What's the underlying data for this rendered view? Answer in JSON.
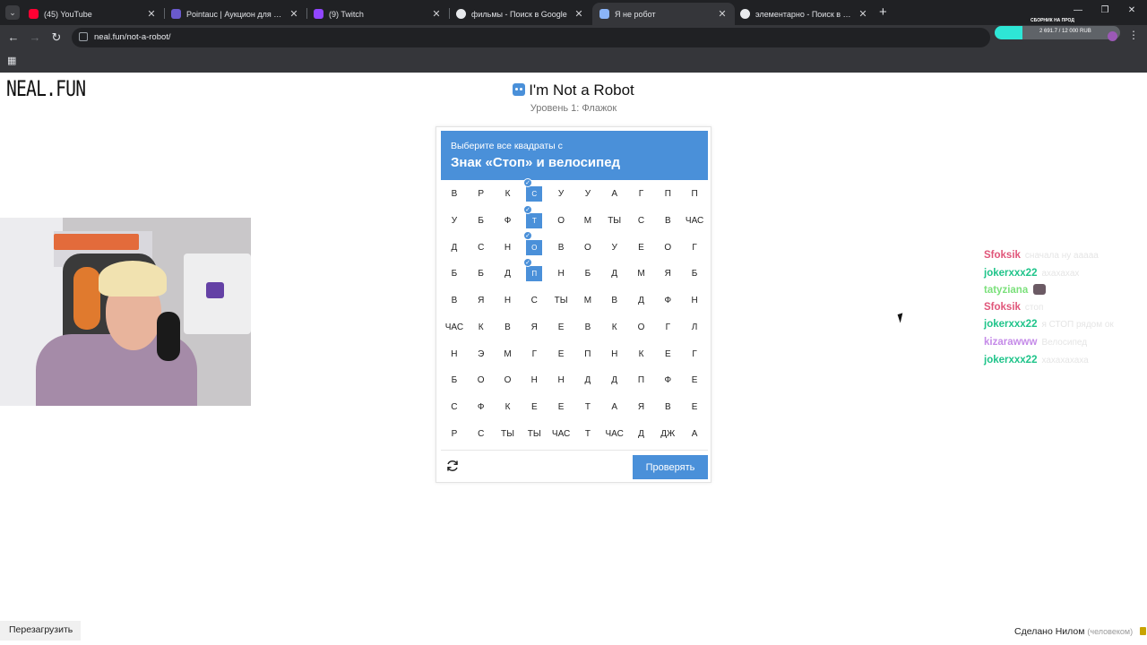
{
  "browser": {
    "tabs": [
      {
        "title": "(45) YouTube",
        "favicon_color": "#ff0033"
      },
      {
        "title": "Pointauc | Аукцион для стримеров",
        "favicon_color": "#6a5acd"
      },
      {
        "title": "(9) Twitch",
        "favicon_color": "#9146ff"
      },
      {
        "title": "фильмы - Поиск в Google",
        "favicon_color": "#e8eaed"
      },
      {
        "title": "Я не робот",
        "favicon_color": "#8ab4f8"
      },
      {
        "title": "элементарно - Поиск в Google",
        "favicon_color": "#e8eaed"
      }
    ],
    "active_tab_index": 4,
    "url": "neal.fun/not-a-robot/",
    "extension": {
      "title": "СБОРНИК НА ПРОД",
      "progress_text": "2 691.7 / 12 000 RUB",
      "progress_fraction": 0.22
    }
  },
  "page": {
    "logo": "NEAL.FUN",
    "title": "I'm Not a Robot",
    "subtitle": "Уровень 1: Флажок"
  },
  "captcha": {
    "instruction_small": "Выберите все квадраты с",
    "instruction_big": "Знак «Стоп» и велосипед",
    "grid": [
      [
        "В",
        "Р",
        "К",
        "С",
        "У",
        "У",
        "А",
        "Г",
        "П",
        "П"
      ],
      [
        "У",
        "Б",
        "Ф",
        "Т",
        "О",
        "М",
        "ТЫ",
        "С",
        "В",
        "ЧАС"
      ],
      [
        "Д",
        "С",
        "Н",
        "О",
        "В",
        "О",
        "У",
        "Е",
        "О",
        "Г"
      ],
      [
        "Б",
        "Б",
        "Д",
        "П",
        "Н",
        "Б",
        "Д",
        "М",
        "Я",
        "Б"
      ],
      [
        "В",
        "Я",
        "Н",
        "С",
        "ТЫ",
        "М",
        "В",
        "Д",
        "Ф",
        "Н"
      ],
      [
        "ЧАС",
        "К",
        "В",
        "Я",
        "Е",
        "В",
        "К",
        "О",
        "Г",
        "Л"
      ],
      [
        "Н",
        "Э",
        "М",
        "Г",
        "Е",
        "П",
        "Н",
        "К",
        "Е",
        "Г"
      ],
      [
        "Б",
        "О",
        "О",
        "Н",
        "Н",
        "Д",
        "Д",
        "П",
        "Ф",
        "Е"
      ],
      [
        "С",
        "Ф",
        "К",
        "Е",
        "Е",
        "Т",
        "А",
        "Я",
        "В",
        "Е"
      ],
      [
        "Р",
        "С",
        "ТЫ",
        "ТЫ",
        "ЧАС",
        "Т",
        "ЧАС",
        "Д",
        "ДЖ",
        "А"
      ]
    ],
    "selected": [
      [
        0,
        3
      ],
      [
        1,
        3
      ],
      [
        2,
        3
      ],
      [
        3,
        3
      ]
    ],
    "verify_label": "Проверять"
  },
  "chat": [
    {
      "user": "Sfoksik",
      "color": "#e0567a",
      "text": "сначала ну ааааа"
    },
    {
      "user": "jokerxxx22",
      "color": "#1fc48a",
      "text": "ахахахах"
    },
    {
      "user": "tatyziana",
      "color": "#7be07b",
      "text": ""
    },
    {
      "user": "Sfoksik",
      "color": "#e0567a",
      "text": "стоп"
    },
    {
      "user": "jokerxxx22",
      "color": "#1fc48a",
      "text": "я СТОП рядом ок"
    },
    {
      "user": "kizarawww",
      "color": "#c58be8",
      "text": "Велосипед"
    },
    {
      "user": "jokerxxx22",
      "color": "#1fc48a",
      "text": "хахахахаха"
    }
  ],
  "footer": {
    "reload": "Перезагрузить",
    "credit": "Сделано Нилом",
    "credit_suffix": "(человеком)"
  }
}
